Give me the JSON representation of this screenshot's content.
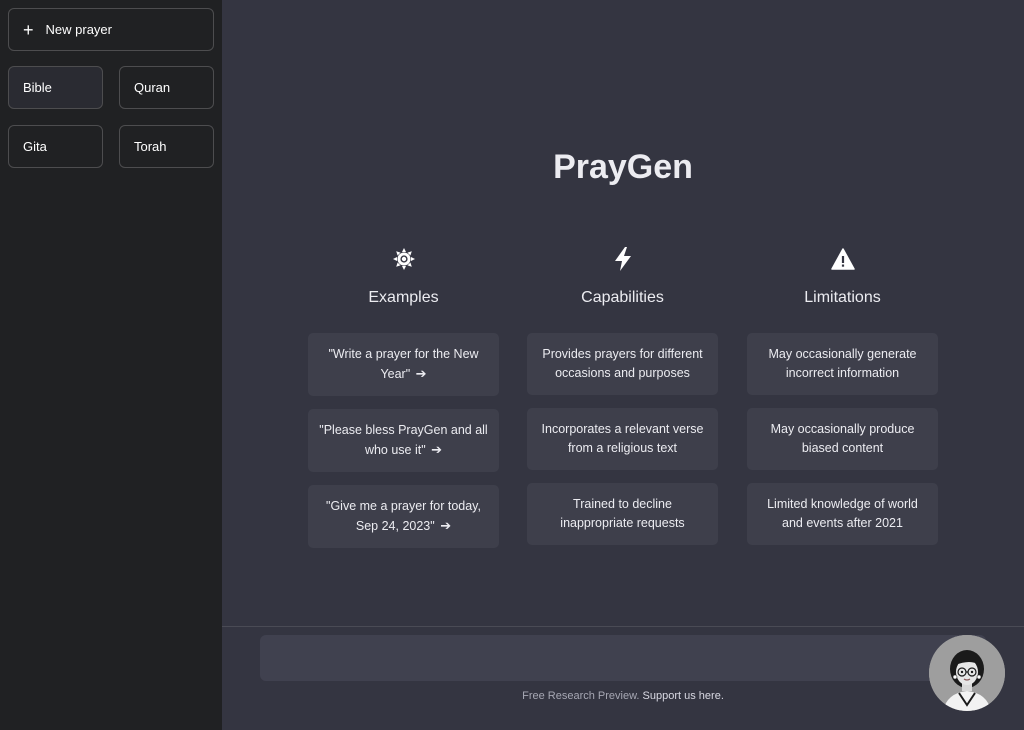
{
  "sidebar": {
    "new_prayer": {
      "icon": "plus-icon",
      "label": "New prayer"
    },
    "books": [
      {
        "label": "Bible",
        "active": true
      },
      {
        "label": "Quran"
      },
      {
        "label": "Gita"
      },
      {
        "label": "Torah"
      }
    ]
  },
  "main": {
    "title": "PrayGen",
    "columns": [
      {
        "icon": "sun-icon",
        "heading": "Examples",
        "cards": [
          "\"Write a prayer for the New Year\"",
          "\"Please bless PrayGen and all who use it\"",
          "\"Give me a prayer for today, Sep 24, 2023\""
        ],
        "card_icon": "arrow-right-icon"
      },
      {
        "icon": "lightning-icon",
        "heading": "Capabilities",
        "cards": [
          "Provides prayers for different occasions and purposes",
          "Incorporates a relevant verse from a religious text",
          "Trained to decline inappropriate requests"
        ]
      },
      {
        "icon": "warning-icon",
        "heading": "Limitations",
        "cards": [
          "May occasionally generate incorrect information",
          "May occasionally produce biased content",
          "Limited knowledge of world and events after 2021"
        ]
      }
    ]
  },
  "input": {
    "value": "",
    "placeholder": ""
  },
  "footer": {
    "text": "Free Research Preview.",
    "link": "Support us here."
  },
  "avatar": {
    "icon": "user-avatar"
  },
  "colors": {
    "sidebar_bg": "#202123",
    "main_bg": "#343541",
    "card_bg": "#3e3f4b",
    "input_bg": "#40414f"
  }
}
